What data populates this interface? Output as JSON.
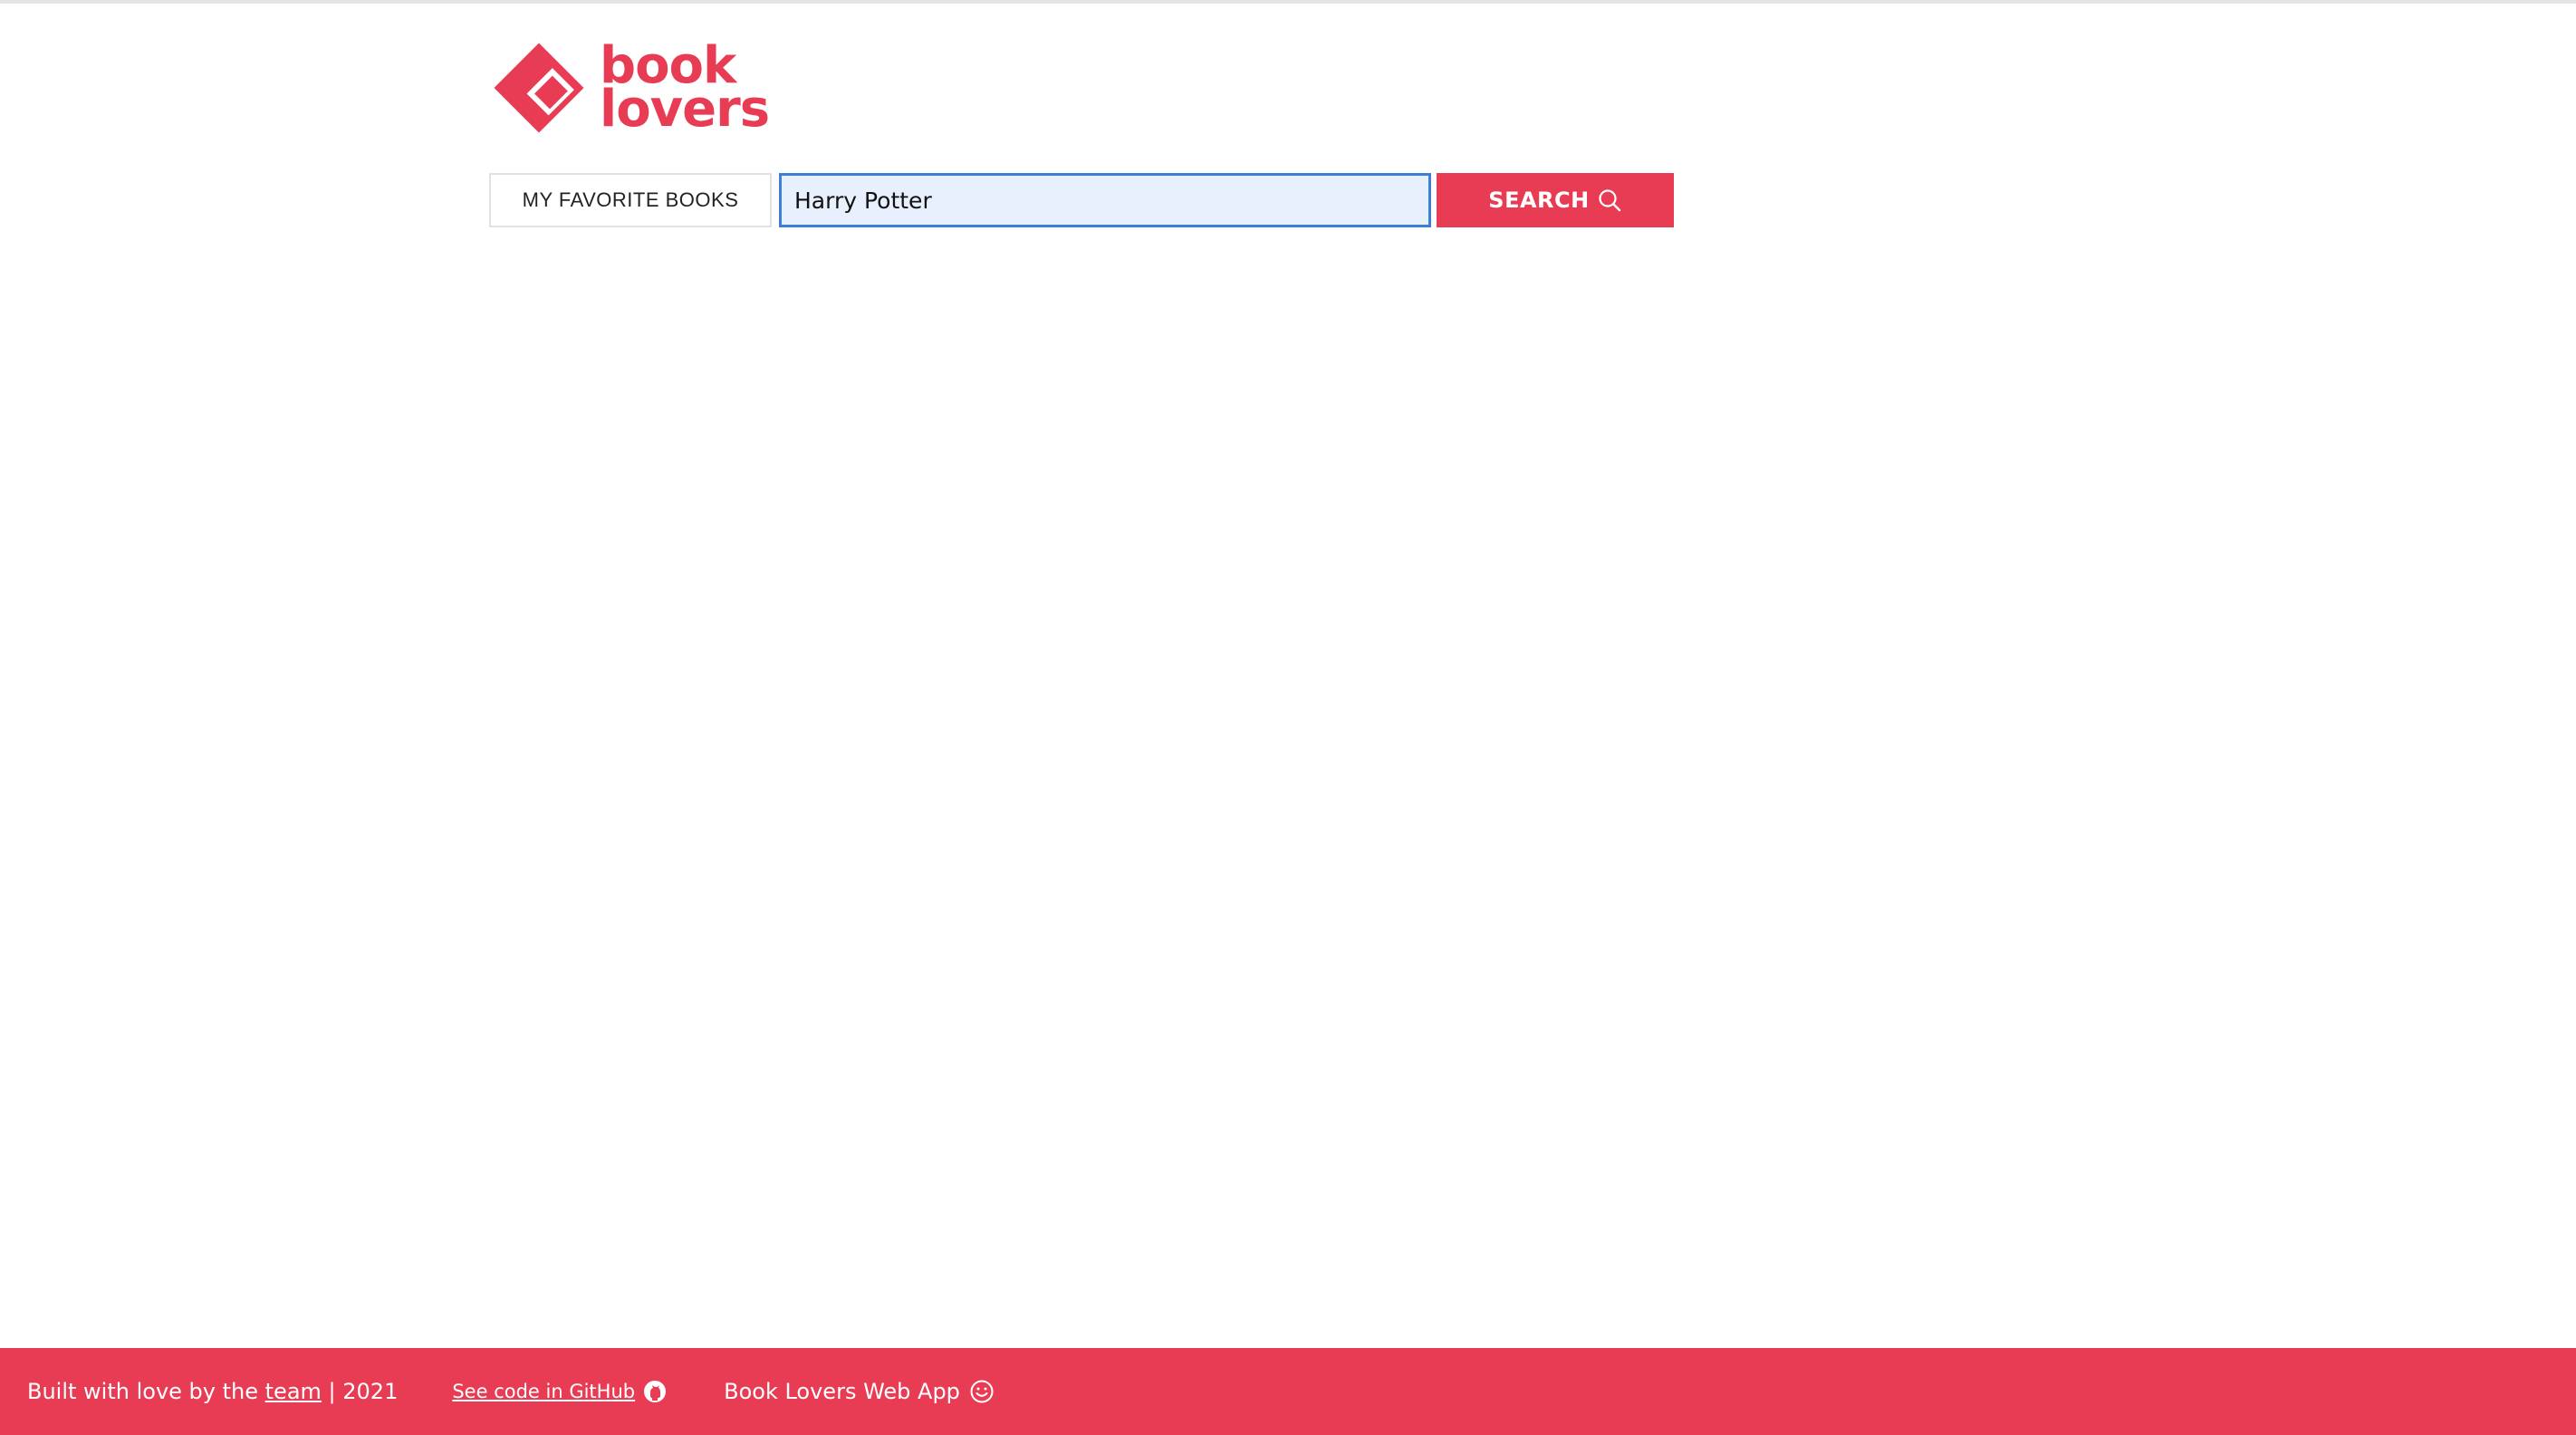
{
  "logo": {
    "line1": "book",
    "line2": "lovers",
    "color": "#e83c54"
  },
  "nav": {
    "favorites_label": "MY FAVORITE BOOKS"
  },
  "search": {
    "value": "Harry Potter",
    "button_label": "SEARCH",
    "icon": "search-icon"
  },
  "footer": {
    "credit_prefix": "Built with love by the",
    "team_link": "team",
    "credit_suffix": "| 2021",
    "github_link": "See code in GitHub",
    "github_icon": "github-icon",
    "app_name": "Book Lovers Web App",
    "app_icon": "smiley-icon",
    "background": "#e83c54"
  }
}
